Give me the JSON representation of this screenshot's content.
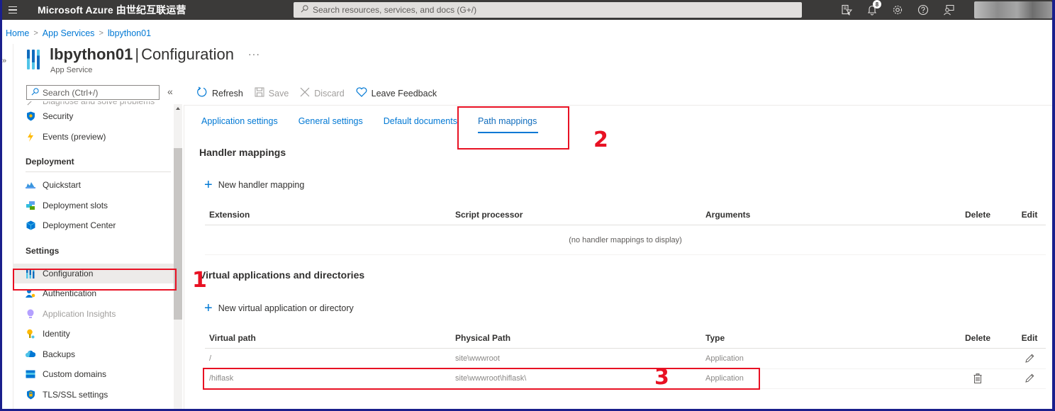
{
  "topbar": {
    "brand": "Microsoft Azure",
    "brand_suffix": "由世纪互联运营",
    "search_placeholder": "Search resources, services, and docs (G+/)",
    "notification_count": "8",
    "icons": [
      "cloud-shell-filter-icon",
      "notifications-bell-icon",
      "settings-gear-icon",
      "help-question-icon",
      "feedback-person-icon"
    ]
  },
  "breadcrumb": [
    {
      "label": "Home"
    },
    {
      "label": "App Services"
    },
    {
      "label": "lbpython01"
    }
  ],
  "header": {
    "resource_name": "lbpython01",
    "separator": "|",
    "blade_name": "Configuration",
    "subtitle": "App Service",
    "more": "···"
  },
  "sidebar": {
    "search_placeholder": "Search (Ctrl+/)",
    "collapse": "«",
    "items_top": [
      {
        "label": "Diagnose and solve problems",
        "icon": "wrench-icon",
        "state": "partial"
      },
      {
        "label": "Security",
        "icon": "shield-icon"
      },
      {
        "label": "Events (preview)",
        "icon": "lightning-icon"
      }
    ],
    "deployment_group": "Deployment",
    "deployment_items": [
      {
        "label": "Quickstart",
        "icon": "cloud-quickstart-icon"
      },
      {
        "label": "Deployment slots",
        "icon": "deployment-slots-icon"
      },
      {
        "label": "Deployment Center",
        "icon": "cube-icon"
      }
    ],
    "settings_group": "Settings",
    "settings_items": [
      {
        "label": "Configuration",
        "icon": "configuration-bars-icon",
        "active": true
      },
      {
        "label": "Authentication",
        "icon": "person-key-icon"
      },
      {
        "label": "Application Insights",
        "icon": "lightbulb-icon",
        "disabled": true
      },
      {
        "label": "Identity",
        "icon": "key-icon"
      },
      {
        "label": "Backups",
        "icon": "cloud-backup-icon"
      },
      {
        "label": "Custom domains",
        "icon": "domain-card-icon"
      },
      {
        "label": "TLS/SSL settings",
        "icon": "shield-lock-icon"
      }
    ]
  },
  "commandbar": {
    "refresh": "Refresh",
    "save": "Save",
    "discard": "Discard",
    "feedback": "Leave Feedback"
  },
  "tabs": [
    {
      "label": "Application settings"
    },
    {
      "label": "General settings"
    },
    {
      "label": "Default documents"
    },
    {
      "label": "Path mappings",
      "active": true
    }
  ],
  "handler_mappings": {
    "title": "Handler mappings",
    "add_label": "New handler mapping",
    "columns": [
      "Extension",
      "Script processor",
      "Arguments",
      "Delete",
      "Edit"
    ],
    "empty_text": "(no handler mappings to display)"
  },
  "virtual_apps": {
    "title": "Virtual applications and directories",
    "add_label": "New virtual application or directory",
    "columns": [
      "Virtual path",
      "Physical Path",
      "Type",
      "Delete",
      "Edit"
    ],
    "rows": [
      {
        "virtual_path": "/",
        "physical_path": "site\\wwwroot",
        "type": "Application",
        "deletable": false
      },
      {
        "virtual_path": "/hiflask",
        "physical_path": "site\\wwwroot\\hiflask\\",
        "type": "Application",
        "deletable": true
      }
    ]
  },
  "annotations": {
    "step1": "1",
    "step2": "2",
    "step3": "3",
    "color": "#e81123"
  },
  "colors": {
    "accent": "#0078d4",
    "topbar": "#3b3a39",
    "frame": "#1a1f8c"
  }
}
